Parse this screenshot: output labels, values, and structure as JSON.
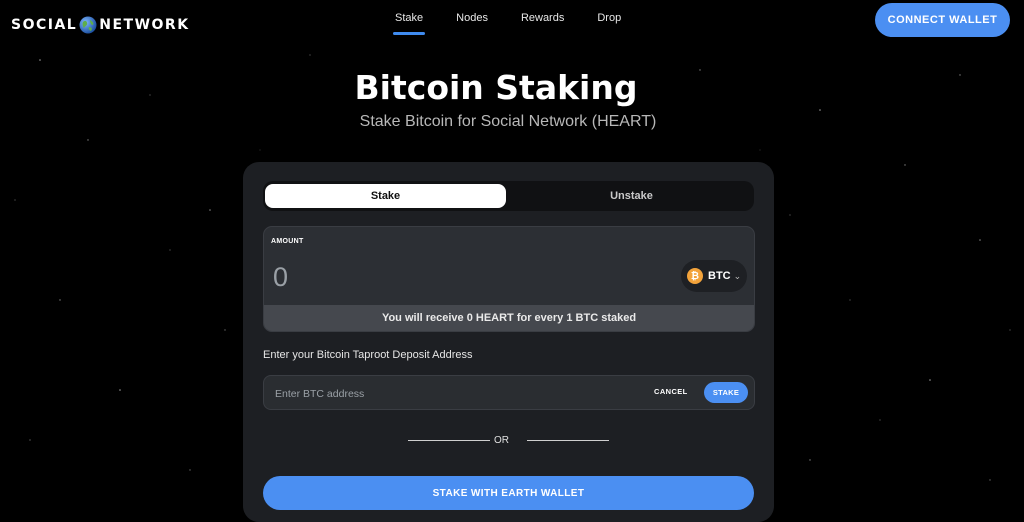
{
  "header": {
    "logo_left": "SOCIAL",
    "logo_right": "NETWORK",
    "connect_label": "CONNECT WALLET"
  },
  "nav": {
    "items": [
      {
        "label": "Stake",
        "active": true
      },
      {
        "label": "Nodes",
        "active": false
      },
      {
        "label": "Rewards",
        "active": false
      },
      {
        "label": "Drop",
        "active": false
      }
    ]
  },
  "hero": {
    "title": "Bitcoin Staking",
    "subtitle": "Stake Bitcoin for Social Network (HEART)"
  },
  "panel": {
    "tabs": [
      {
        "label": "Stake",
        "active": true
      },
      {
        "label": "Unstake",
        "active": false
      }
    ],
    "amount_label": "AMOUNT",
    "amount_value": "0",
    "token": {
      "symbol": "BTC",
      "icon": "bitcoin-icon"
    },
    "receive_text": "You will receive 0 HEART for every 1 BTC staked",
    "address_label": "Enter your Bitcoin Taproot Deposit Address",
    "address_placeholder": "Enter BTC address",
    "address_value": "",
    "cancel_label": "CANCEL",
    "stake_label": "STAKE",
    "or_label": "OR",
    "earth_label": "STAKE WITH EARTH WALLET"
  },
  "colors": {
    "accent": "#4b8ff2",
    "background": "#000000",
    "panel": "#1d1f23",
    "bitcoin": "#f3a33b"
  }
}
